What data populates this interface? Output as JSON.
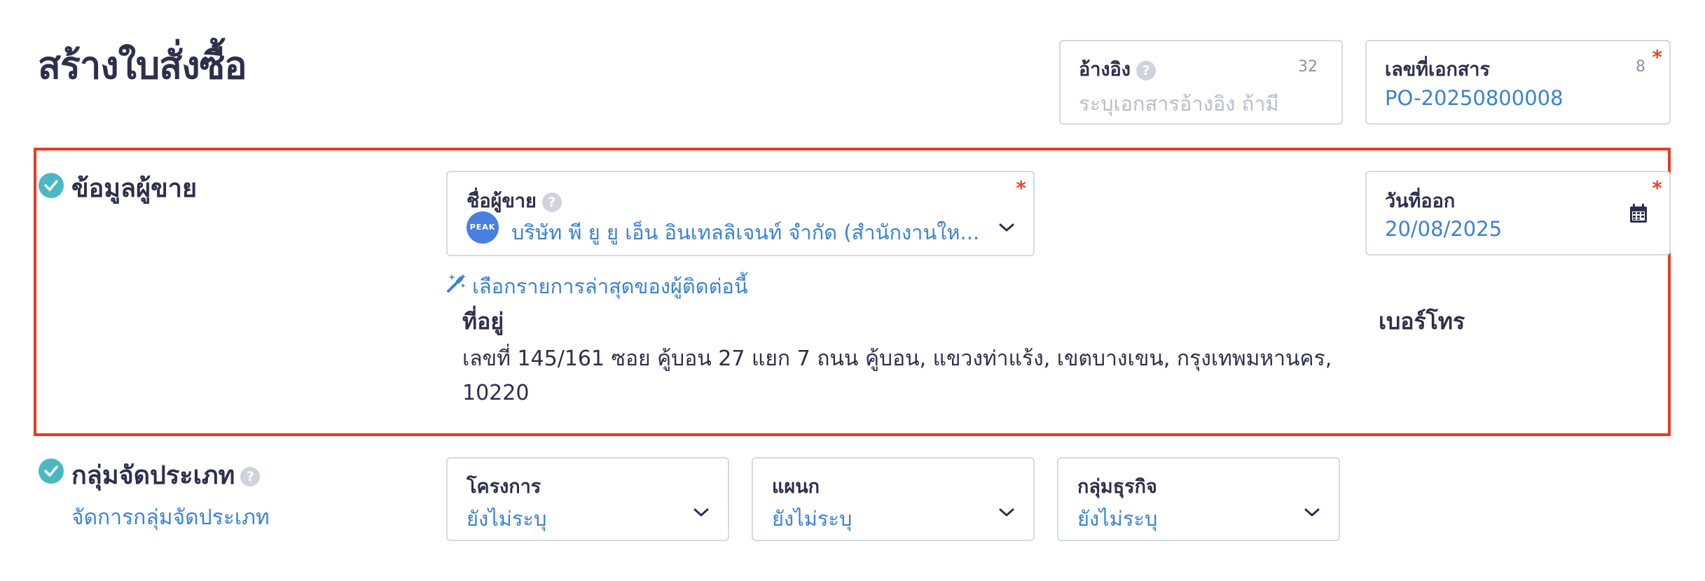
{
  "page": {
    "title": "สร้างใบสั่งซื้อ"
  },
  "reference": {
    "label": "อ้างอิง",
    "placeholder": "ระบุเอกสารอ้างอิง ถ้ามี",
    "counter": "32"
  },
  "doc_number": {
    "label": "เลขที่เอกสาร",
    "value": "PO-20250800008",
    "counter": "8",
    "required": "*"
  },
  "vendor_section": {
    "title": "ข้อมูลผู้ขาย",
    "vendor_name": {
      "label": "ชื่อผู้ขาย",
      "value": "บริษัท พี ยู ยู เอ็น อินเทลลิเจนท์ จำกัด (สำนักงานให...",
      "avatar_text": "PEAK",
      "required": "*"
    },
    "issue_date": {
      "label": "วันที่ออก",
      "value": "20/08/2025",
      "required": "*"
    },
    "recent_link": "เลือกรายการล่าสุดของผู้ติดต่อนี้",
    "address_label": "ที่อยู่",
    "address_line1": "เลขที่ 145/161 ซอย คู้บอน 27 แยก 7 ถนน คู้บอน, แขวงท่าแร้ง, เขตบางเขน, กรุงเทพมหานคร,",
    "address_line2": "10220",
    "phone_label": "เบอร์โทร"
  },
  "category_section": {
    "title": "กลุ่มจัดประเภท",
    "manage_link": "จัดการกลุ่มจัดประเภท",
    "project": {
      "label": "โครงการ",
      "value": "ยังไม่ระบุ"
    },
    "department": {
      "label": "แผนก",
      "value": "ยังไม่ระบุ"
    },
    "business_group": {
      "label": "กลุ่มธุรกิจ",
      "value": "ยังไม่ระบุ"
    }
  },
  "colors": {
    "accent": "#3b82d6",
    "required": "#e8472a",
    "check": "#4bb8c1",
    "highlight": "#e23c22"
  },
  "icons": [
    "help-icon",
    "check-icon",
    "chevron-down-icon",
    "calendar-icon",
    "magic-wand-icon"
  ]
}
